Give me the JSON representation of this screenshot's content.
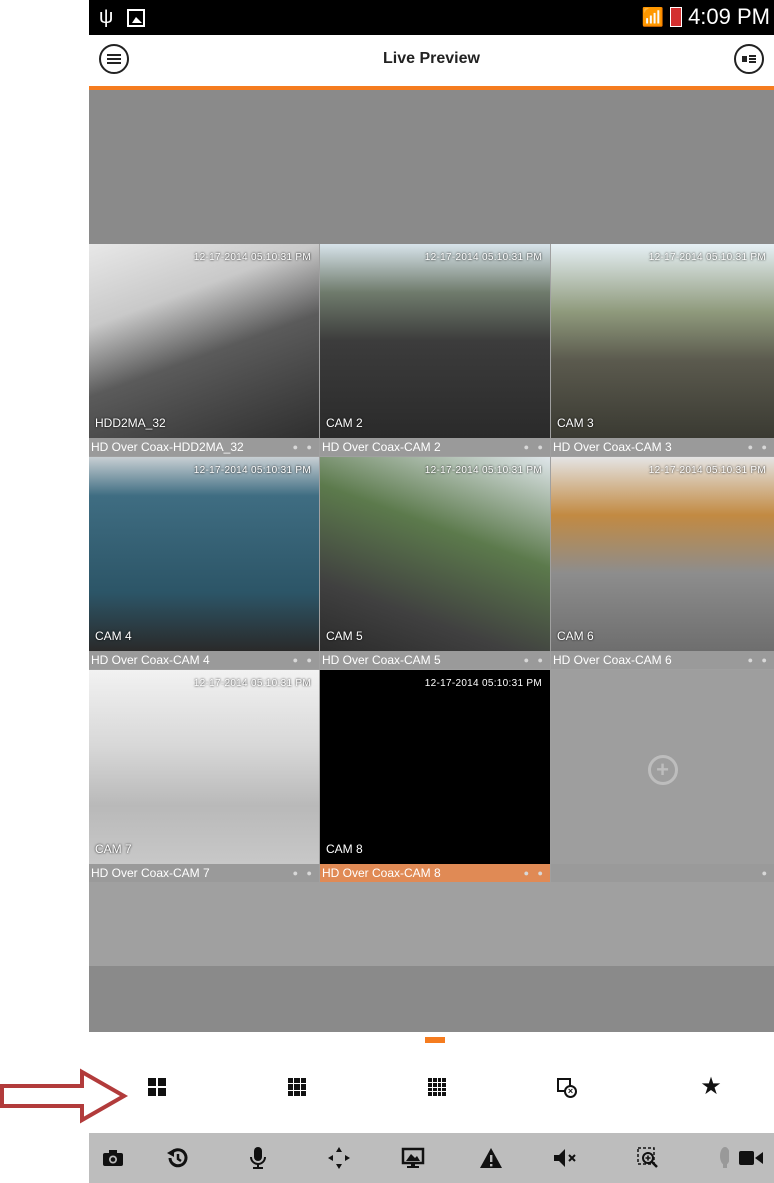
{
  "status_bar": {
    "time": "4:09 PM",
    "icons": [
      "usb-icon",
      "image-icon",
      "wifi-icon",
      "battery-icon"
    ]
  },
  "app_bar": {
    "title": "Live Preview",
    "left_icon": "menu-icon",
    "right_icon": "device-list-icon"
  },
  "accent_color": "#f57c1f",
  "channels": [
    {
      "timestamp": "12-17-2014 05:10:31 PM",
      "cam_label": "HDD2MA_32",
      "caption": "HD Over Coax-HDD2MA_32",
      "selected": false
    },
    {
      "timestamp": "12-17-2014 05:10:31 PM",
      "cam_label": "CAM 2",
      "caption": "HD Over Coax-CAM 2",
      "selected": false
    },
    {
      "timestamp": "12-17-2014 05:10:31 PM",
      "cam_label": "CAM 3",
      "caption": "HD Over Coax-CAM 3",
      "selected": false
    },
    {
      "timestamp": "12-17-2014 05:10:31 PM",
      "cam_label": "CAM 4",
      "caption": "HD Over Coax-CAM 4",
      "selected": false
    },
    {
      "timestamp": "12-17-2014 05:10:31 PM",
      "cam_label": "CAM 5",
      "caption": "HD Over Coax-CAM 5",
      "selected": false
    },
    {
      "timestamp": "12-17-2014 05:10:31 PM",
      "cam_label": "CAM 6",
      "caption": "HD Over Coax-CAM 6",
      "selected": false
    },
    {
      "timestamp": "12-17-2014 05:10:31 PM",
      "cam_label": "CAM 7",
      "caption": "HD Over Coax-CAM 7",
      "selected": false
    },
    {
      "timestamp": "12-17-2014 05:10:31 PM",
      "cam_label": "CAM 8",
      "caption": "HD Over Coax-CAM 8",
      "selected": true
    }
  ],
  "empty_slot_icon": "add-channel-icon",
  "split_modes": [
    "split-4-icon",
    "split-9-icon",
    "split-16-icon",
    "close-all-icon",
    "favorites-icon"
  ],
  "toolbar_icons": [
    "snapshot-icon",
    "playback-icon",
    "talk-icon",
    "ptz-icon",
    "display-mode-icon",
    "alarm-icon",
    "mute-icon",
    "zoom-icon",
    "ptz-menu-icon",
    "record-icon"
  ]
}
